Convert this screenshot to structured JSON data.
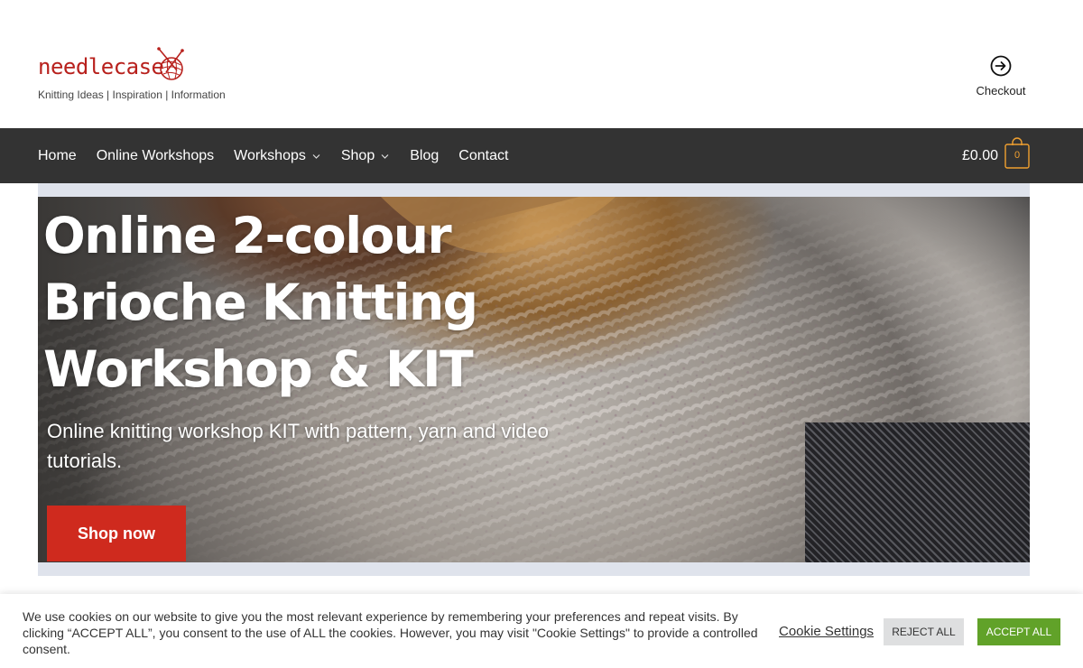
{
  "header": {
    "logo_text": "needlecase",
    "tagline": "Knitting Ideas | Inspiration | Information",
    "checkout_label": "Checkout",
    "logo_icon": "yarn-ball-icon",
    "checkout_icon": "arrow-circle-right-icon",
    "brand_color": "#b8211d"
  },
  "nav": {
    "items": [
      {
        "label": "Home",
        "has_dropdown": false
      },
      {
        "label": "Online Workshops",
        "has_dropdown": false
      },
      {
        "label": "Workshops",
        "has_dropdown": true
      },
      {
        "label": "Shop",
        "has_dropdown": true
      },
      {
        "label": "Blog",
        "has_dropdown": false
      },
      {
        "label": "Contact",
        "has_dropdown": false
      }
    ],
    "cart_total": "£0.00",
    "cart_count": "0",
    "cart_icon": "shopping-bag-icon",
    "background_color": "#333333",
    "cart_accent": "#f0a030"
  },
  "hero": {
    "title": "Online 2-colour Brioche Knitting Workshop & KIT",
    "subtitle": "Online knitting workshop KIT with pattern, yarn and video tutorials.",
    "button_label": "Shop now",
    "button_color": "#cf2a1e"
  },
  "cookie": {
    "text": "We use cookies on our website to give you the most relevant experience by remembering your preferences and repeat visits. By clicking “ACCEPT ALL”, you consent to the use of ALL the cookies. However, you may visit \"Cookie Settings\" to provide a controlled consent.",
    "settings_label": "Cookie Settings",
    "reject_label": "REJECT ALL",
    "accept_label": "ACCEPT ALL",
    "accept_color": "#61a229"
  }
}
